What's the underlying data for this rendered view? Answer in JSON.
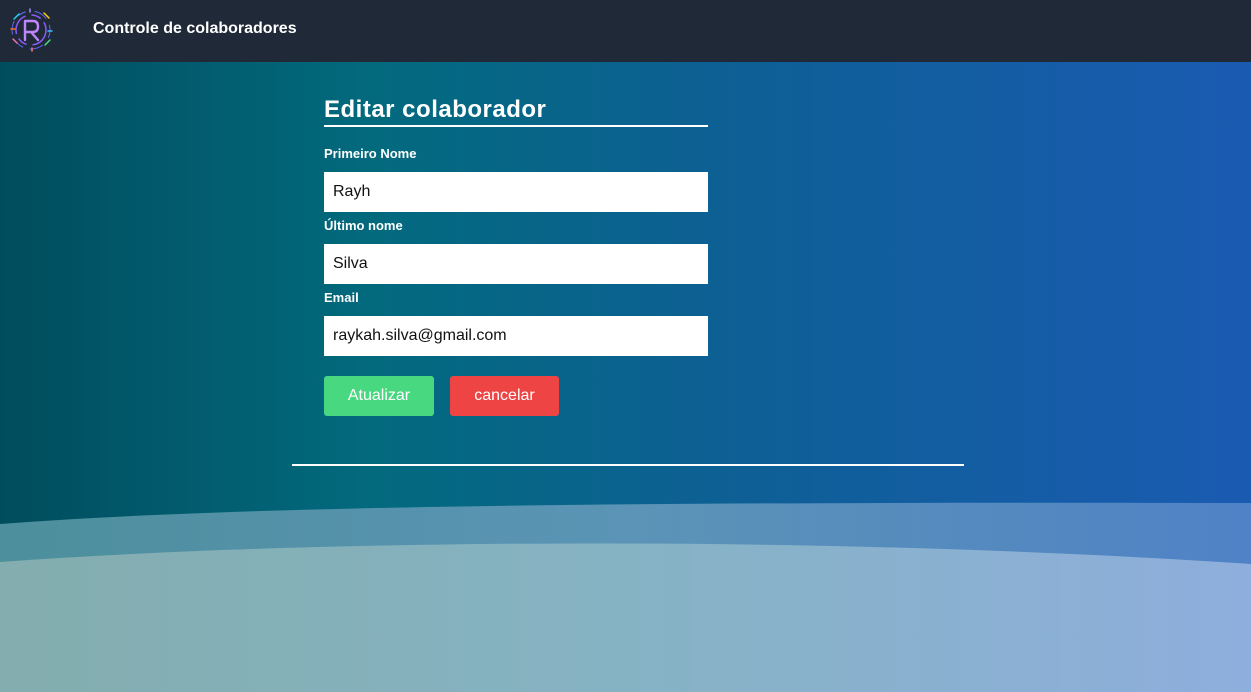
{
  "navbar": {
    "logo_icon": "r-logo-icon",
    "title": "Controle de colaboradores"
  },
  "form": {
    "title": "Editar colaborador",
    "first_name": {
      "label": "Primeiro Nome",
      "value": "Rayh"
    },
    "last_name": {
      "label": "Último nome",
      "value": "Silva"
    },
    "email": {
      "label": "Email",
      "value": "raykah.silva@gmail.com"
    },
    "update_label": "Atualizar",
    "cancel_label": "cancelar"
  },
  "colors": {
    "navbar_bg": "#1f2937",
    "update_button": "#48d880",
    "cancel_button": "#ef4444",
    "background_start": "#004d5d",
    "background_end": "#1a5bb2"
  }
}
